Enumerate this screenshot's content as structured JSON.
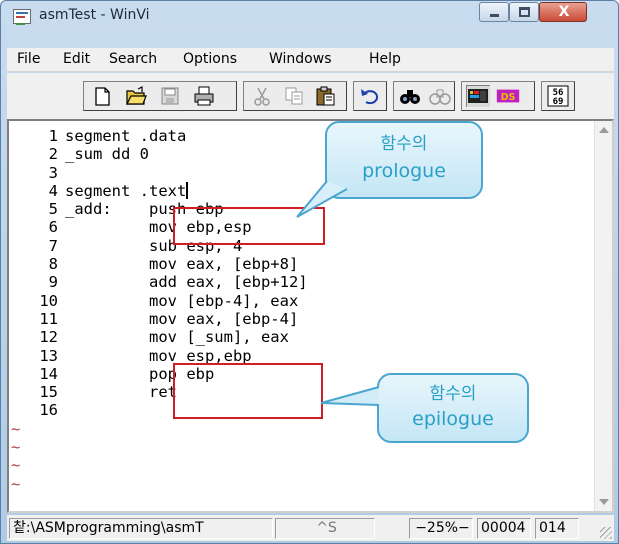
{
  "window": {
    "title": "asmTest - WinVi",
    "close_glyph": "X"
  },
  "menu": [
    "File",
    "Edit",
    "Search",
    "Options",
    "Windows",
    "Help"
  ],
  "toolbar": {
    "icons": [
      "new-file-icon",
      "open-folder-icon",
      "save-icon",
      "print-icon",
      "cut-icon",
      "copy-icon",
      "paste-icon",
      "undo-icon",
      "find-icon",
      "find-next-icon",
      "color-icon",
      "ds-icon",
      "hex-icon"
    ],
    "hex_label_top": "56",
    "hex_label_bottom": "69",
    "ds_label": "DS"
  },
  "editor": {
    "lines": [
      {
        "num": "1",
        "text": "segment .data"
      },
      {
        "num": "2",
        "text": "_sum dd 0"
      },
      {
        "num": "3",
        "text": ""
      },
      {
        "num": "4",
        "text": "segment .text"
      },
      {
        "num": "5",
        "text": "_add:    push ebp"
      },
      {
        "num": "6",
        "text": "         mov ebp,esp"
      },
      {
        "num": "7",
        "text": "         sub esp, 4"
      },
      {
        "num": "8",
        "text": "         mov eax, [ebp+8]"
      },
      {
        "num": "9",
        "text": "         add eax, [ebp+12]"
      },
      {
        "num": "10",
        "text": "         mov [ebp-4], eax"
      },
      {
        "num": "11",
        "text": "         mov eax, [ebp-4]"
      },
      {
        "num": "12",
        "text": "         mov [_sum], eax"
      },
      {
        "num": "13",
        "text": "         mov esp,ebp"
      },
      {
        "num": "14",
        "text": "         pop ebp"
      },
      {
        "num": "15",
        "text": "         ret"
      },
      {
        "num": "16",
        "text": ""
      }
    ],
    "empty_marker": "~",
    "empty_lines": 4
  },
  "callouts": {
    "prologue": {
      "korean": "함수의",
      "english": "prologue"
    },
    "epilogue": {
      "korean": "함수의",
      "english": "epilogue"
    }
  },
  "colors": {
    "highlight": "#d01e27",
    "callout_border": "#4aa6cf",
    "callout_text": "#2aa0c8"
  },
  "status": {
    "path": "챁:\\ASMprogramming\\asmT",
    "mode": "^S",
    "percent": "−25%−",
    "line": "00004",
    "col": "014"
  }
}
